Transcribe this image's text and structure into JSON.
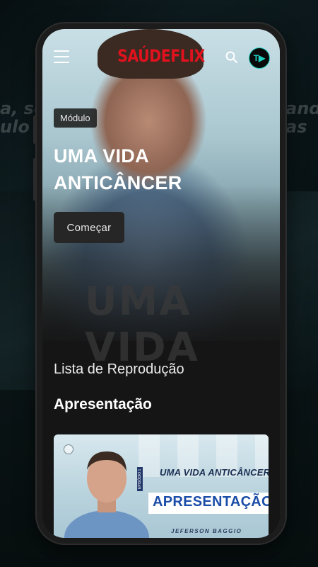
{
  "app": {
    "logo": "SAÚDEFLIX",
    "avatar_initials": "T▶"
  },
  "hero": {
    "badge": "Módulo",
    "title": "UMA VIDA ANTICÂNCER",
    "watermark": "UMA VIDA",
    "cta_label": "Começar"
  },
  "playlist": {
    "label": "Lista de Reprodução",
    "section_title": "Apresentação",
    "episodes": [
      {
        "title": "UMA VIDA ANTICÂNCER",
        "subtitle": "APRESENTAÇÃO",
        "episode_tag": "EPISÓDIO 1",
        "author": "JEFERSON BAGGIO"
      }
    ]
  },
  "background_promo": {
    "left_words": "a, so\nulo Co",
    "right_words": "ando\nas"
  },
  "colors": {
    "brand": "#e1121e",
    "avatar_accent": "#1dd4c4",
    "screen_bg": "#151515"
  },
  "icons": [
    "menu-icon",
    "search-icon"
  ]
}
